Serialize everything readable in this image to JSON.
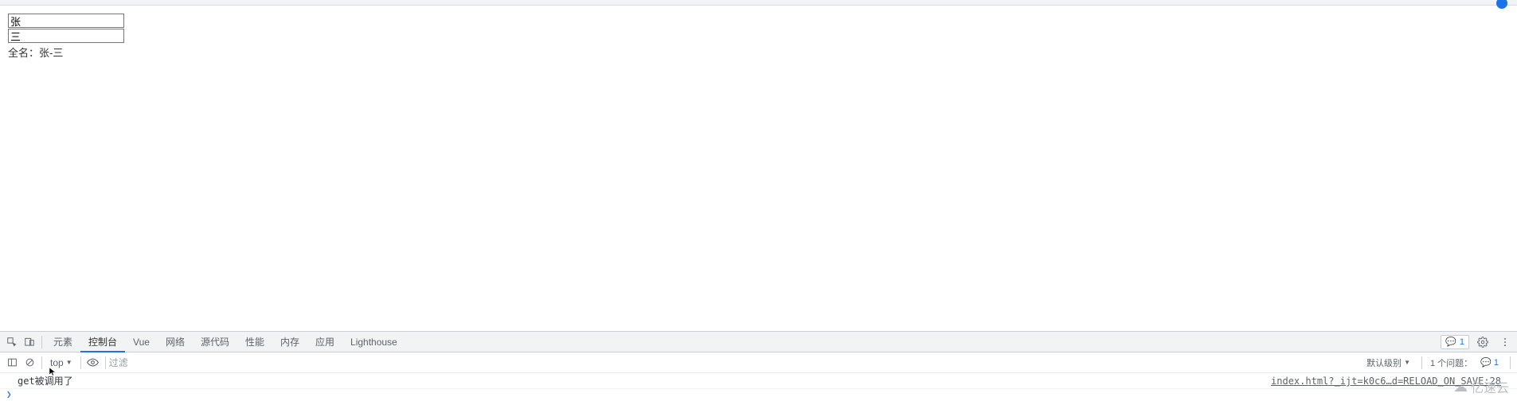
{
  "page": {
    "input1_value": "张",
    "input2_value": "三",
    "fullname_label": "全名：",
    "fullname_value": "张-三"
  },
  "devtools": {
    "tabs": {
      "elements": "元素",
      "console": "控制台",
      "vue": "Vue",
      "network": "网络",
      "sources": "源代码",
      "performance": "性能",
      "memory": "内存",
      "application": "应用",
      "lighthouse": "Lighthouse"
    },
    "right_chip_count": "1",
    "console_toolbar": {
      "context": "top",
      "filter_placeholder": "过滤",
      "level": "默认级别",
      "issues_label": "1 个问题：",
      "issues_count": "1"
    },
    "console_log": {
      "message": "get被调用了",
      "source": "index.html?_ijt=k0c6…d=RELOAD_ON_SAVE:28"
    }
  },
  "watermark": "亿速云"
}
